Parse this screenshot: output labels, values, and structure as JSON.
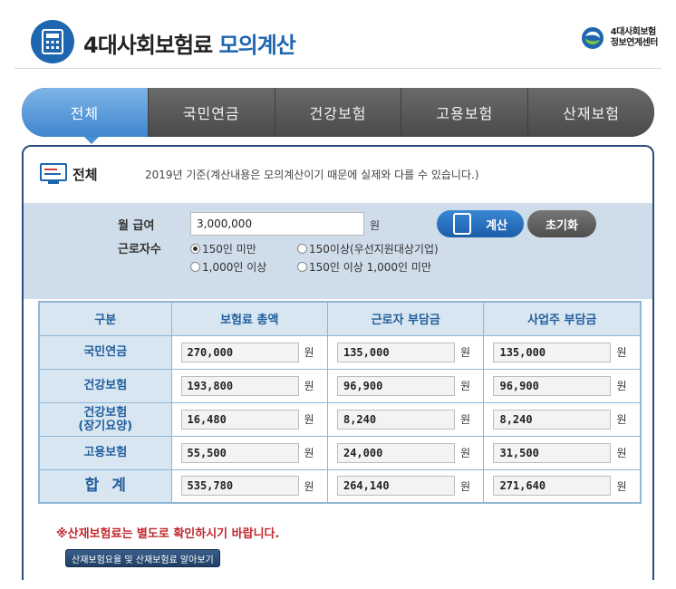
{
  "header": {
    "title_main": "4대사회보험료",
    "title_accent": "모의계산",
    "org_line1": "4대사회보험",
    "org_line2": "정보연계센터"
  },
  "tabs": [
    {
      "label": "전체",
      "active": true
    },
    {
      "label": "국민연금",
      "active": false
    },
    {
      "label": "건강보험",
      "active": false
    },
    {
      "label": "고용보험",
      "active": false
    },
    {
      "label": "산재보험",
      "active": false
    }
  ],
  "section": {
    "title": "전체",
    "note": "2019년 기준(계산내용은 모의계산이기 때문에 실제와 다를 수 있습니다.)"
  },
  "form": {
    "salary_label": "월 급여",
    "salary_value": "3,000,000",
    "unit": "원",
    "workers_label": "근로자수",
    "options": [
      {
        "label": "150인 미만",
        "selected": true
      },
      {
        "label": "150이상(우선지원대상기업)",
        "selected": false
      },
      {
        "label": "1,000인 이상",
        "selected": false
      },
      {
        "label": "150인 이상 1,000인 미만",
        "selected": false
      }
    ],
    "calc_label": "계산",
    "reset_label": "초기화"
  },
  "table": {
    "headers": [
      "구분",
      "보험료 총액",
      "근로자 부담금",
      "사업주 부담금"
    ],
    "unit": "원",
    "rows": [
      {
        "name": "국민연금",
        "total": "270,000",
        "worker": "135,000",
        "employer": "135,000"
      },
      {
        "name": "건강보험",
        "total": "193,800",
        "worker": "96,900",
        "employer": "96,900"
      },
      {
        "name": "건강보험\n(장기요양)",
        "total": "16,480",
        "worker": "8,240",
        "employer": "8,240"
      },
      {
        "name": "고용보험",
        "total": "55,500",
        "worker": "24,000",
        "employer": "31,500"
      },
      {
        "name": "합계",
        "total": "535,780",
        "worker": "264,140",
        "employer": "271,640"
      }
    ]
  },
  "notice": "※산재보험료는 별도로 확인하시기 바랍니다.",
  "info_button": "산재보험요율 및 산재보험료 알아보기",
  "colors": {
    "accent_blue": "#1e66b0",
    "tab_active": "#4a8ed3",
    "warning_red": "#c0282e"
  }
}
